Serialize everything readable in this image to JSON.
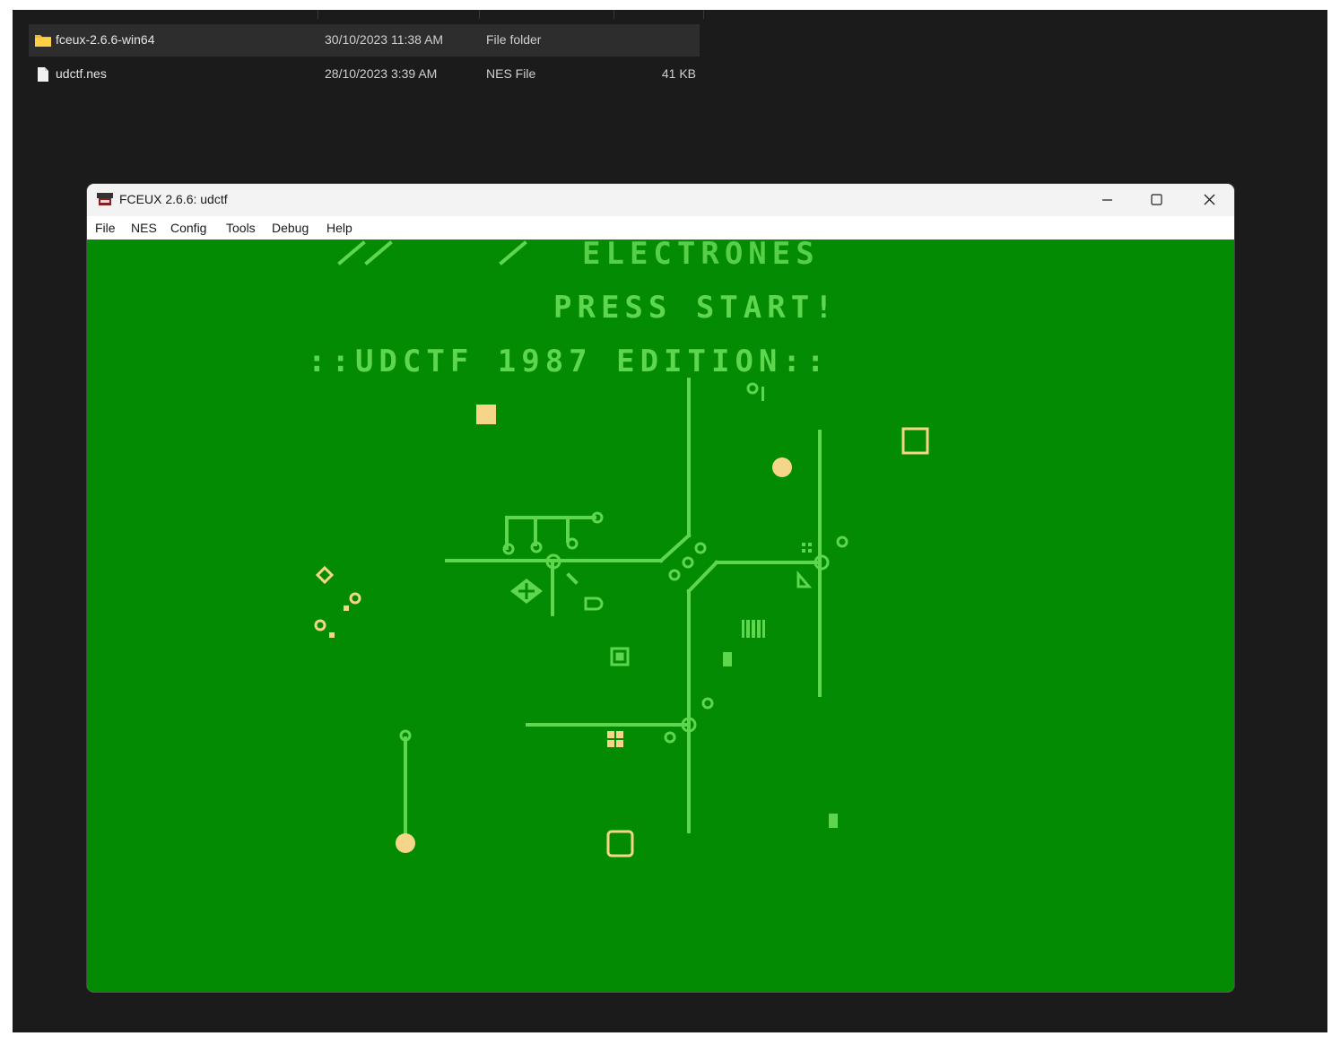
{
  "explorer": {
    "files": [
      {
        "name": "fceux-2.6.6-win64",
        "date": "30/10/2023 11:38 AM",
        "type": "File folder",
        "size": "",
        "icon": "folder-icon",
        "selected": true
      },
      {
        "name": "udctf.nes",
        "date": "28/10/2023 3:39 AM",
        "type": "NES File",
        "size": "41 KB",
        "icon": "file-icon",
        "selected": false
      }
    ]
  },
  "window": {
    "title": "FCEUX 2.6.6: udctf",
    "app_icon": "fceux-icon",
    "controls": {
      "minimize": "minimize-icon",
      "maximize": "maximize-icon",
      "close": "close-icon"
    }
  },
  "menu": {
    "items": [
      "File",
      "NES",
      "Config",
      "Tools",
      "Debug",
      "Help"
    ]
  },
  "game": {
    "title_line": "ELECTRONES",
    "prompt": "PRESS START!",
    "edition": "::UDCTF 1987 EDITION::",
    "colors": {
      "background": "#038b04",
      "circuit": "#5ed64e",
      "pickup": "#f5d58a"
    }
  }
}
